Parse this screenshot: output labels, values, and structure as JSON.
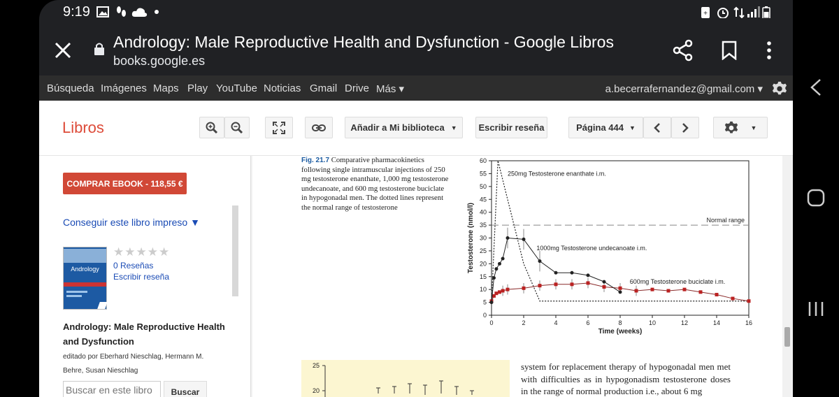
{
  "status": {
    "time": "9:19"
  },
  "browser": {
    "title": "Andrology: Male Reproductive Health and Dysfunction - Google Libros",
    "url": "books.google.es"
  },
  "gbar": {
    "items": [
      "Búsqueda",
      "Imágenes",
      "Maps",
      "Play",
      "YouTube",
      "Noticias",
      "Gmail",
      "Drive",
      "Más ▾"
    ],
    "email": "a.becerrafernandez@gmail.com ▾"
  },
  "toolbar": {
    "brand": "Libros",
    "add_library": "Añadir a Mi biblioteca",
    "write_review": "Escribir reseña",
    "page": "Página 444"
  },
  "sidebar": {
    "buy": "COMPRAR EBOOK - 118,55 €",
    "print": "Conseguir este libro impreso ▼",
    "cover_title": "Andrology",
    "stars": "★★★★★",
    "reviews": "0 Reseñas",
    "write_review": "Escribir reseña",
    "book_title": "Andrology: Male Reproductive Health and Dysfunction",
    "authors": "editado por Eberhard Nieschlag, Hermann M. Behre, Susan Nieschlag",
    "search_placeholder": "Buscar en este libro",
    "search_button": "Buscar"
  },
  "page": {
    "fig_label": "Fig. 21.7",
    "fig_caption": "Comparative pharmacokinetics following single intramuscular injections of 250 mg testosterone enanthate, 1,000 mg testosterone undecanoate, and 600 mg testosterone buciclate in hypogonadal men. The dotted lines represent the normal range of testosterone",
    "body_text": "system for replacement therapy of hypogonadal men met with difficulties as in hypogonadism testosterone doses in the range of normal production i.e., about 6 mg",
    "fig2_ticks": [
      "25",
      "20"
    ]
  },
  "chart_data": {
    "type": "line",
    "xlabel": "Time (weeks)",
    "ylabel": "Testosterone (nmol/l)",
    "xlim": [
      0,
      16
    ],
    "ylim": [
      0,
      60
    ],
    "xticks": [
      0,
      2,
      4,
      6,
      8,
      10,
      12,
      14,
      16
    ],
    "yticks": [
      0,
      5,
      10,
      15,
      20,
      25,
      30,
      35,
      40,
      45,
      50,
      55,
      60
    ],
    "normal_range": {
      "value": 35,
      "label": "Normal range"
    },
    "series": [
      {
        "name": "250mg Testosterone enanthate i.m.",
        "style": "dotted",
        "x": [
          0,
          0.4,
          1,
          2,
          3,
          8,
          16
        ],
        "y": [
          5,
          60,
          45,
          20,
          5.5,
          5.5,
          5.5
        ]
      },
      {
        "name": "1000mg Testosterone undecanoate i.m.",
        "style": "black-circles",
        "x": [
          0,
          0.15,
          0.3,
          0.5,
          0.7,
          1,
          2,
          3,
          4,
          5,
          6,
          7,
          8
        ],
        "y": [
          5,
          14.5,
          18,
          20,
          22,
          30,
          29.5,
          21,
          16.5,
          16.5,
          15.5,
          13,
          9
        ]
      },
      {
        "name": "600mg Testosterone buciclate i.m.",
        "style": "red-squares",
        "x": [
          0,
          0.15,
          0.3,
          0.5,
          0.7,
          1,
          2,
          3,
          4,
          5,
          6,
          7,
          8,
          9,
          10,
          11,
          12,
          13,
          14,
          15,
          16
        ],
        "y": [
          5.5,
          7.5,
          8.5,
          9,
          9.5,
          10,
          10.5,
          11.5,
          12,
          12,
          12.5,
          11,
          10.5,
          9.5,
          10,
          9.5,
          10,
          9,
          8,
          6.5,
          5.5
        ]
      }
    ]
  }
}
